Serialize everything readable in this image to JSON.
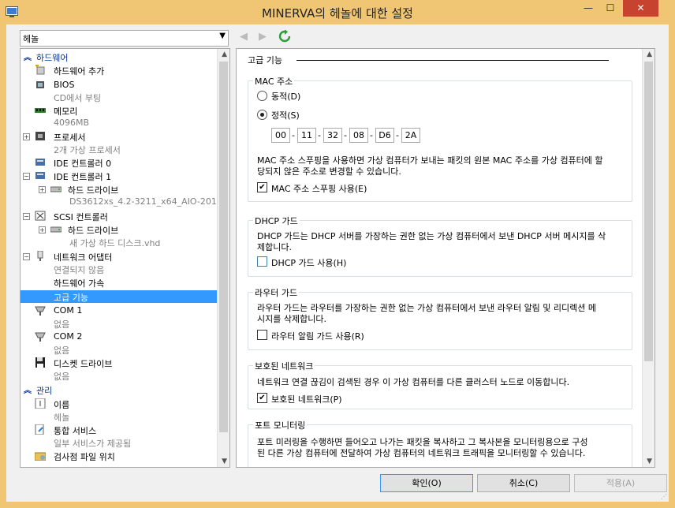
{
  "window": {
    "title": "MINERVA의 헤놀에 대한 설정",
    "minimize": "—",
    "maximize": "☐",
    "close": "✕"
  },
  "vm_selector": {
    "value": "헤놀"
  },
  "tree": {
    "hardware_section": "하드웨어",
    "items": [
      {
        "label": "하드웨어 추가",
        "sub": ""
      },
      {
        "label": "BIOS",
        "sub": "CD에서 부팅"
      },
      {
        "label": "메모리",
        "sub": "4096MB"
      },
      {
        "label": "프로세서",
        "sub": "2개 가상 프로세서"
      },
      {
        "label": "IDE 컨트롤러 0",
        "sub": ""
      },
      {
        "label": "IDE 컨트롤러 1",
        "sub": ""
      },
      {
        "label": "하드 드라이브",
        "sub": "DS3612xs_4.2-3211_x64_AIO-201..."
      },
      {
        "label": "SCSI 컨트롤러",
        "sub": ""
      },
      {
        "label": "하드 드라이브",
        "sub": "새 가상 하드 디스크.vhd"
      },
      {
        "label": "네트워크 어댑터",
        "sub": "연결되지 않음"
      },
      {
        "label": "하드웨어 가속",
        "sub": ""
      },
      {
        "label": "고급 기능",
        "sub": ""
      },
      {
        "label": "COM 1",
        "sub": "없음"
      },
      {
        "label": "COM 2",
        "sub": "없음"
      },
      {
        "label": "디스켓 드라이브",
        "sub": "없음"
      }
    ],
    "management_section": "관리",
    "mgmt_items": [
      {
        "label": "이름",
        "sub": "헤놀"
      },
      {
        "label": "통합 서비스",
        "sub": "일부 서비스가 제공됨"
      },
      {
        "label": "검사점 파일 위치",
        "sub": ""
      }
    ]
  },
  "panel": {
    "heading": "고급 기능",
    "mac": {
      "title": "MAC 주소",
      "dynamic": "동적(D)",
      "static": "정적(S)",
      "octets": [
        "00",
        "11",
        "32",
        "08",
        "D6",
        "2A"
      ],
      "desc1": "MAC 주소 스푸핑을 사용하면 가상 컴퓨터가 보내는 패킷의 원본 MAC 주소를 가상 컴퓨터에 할",
      "desc2": "당되지 않은 주소로 변경할 수 있습니다.",
      "spoof_label": "MAC 주소 스푸핑 사용(E)",
      "spoof_checked": true
    },
    "dhcp": {
      "title": "DHCP 가드",
      "desc1": "DHCP 가드는 DHCP 서버를 가장하는 권한 없는 가상 컴퓨터에서 보낸 DHCP 서버 메시지를 삭",
      "desc2": "제합니다.",
      "label": "DHCP 가드 사용(H)",
      "checked": false
    },
    "router": {
      "title": "라우터 가드",
      "desc1": "라우터 가드는 라우터를 가장하는 권한 없는 가상 컴퓨터에서 보낸 라우터 알림 및 리디렉션 메",
      "desc2": "시지를 삭제합니다.",
      "label": "라우터 알림 가드 사용(R)",
      "checked": false
    },
    "protected": {
      "title": "보호된 네트워크",
      "desc1": "네트워크 연결 끊김이 검색된 경우 이 가상 컴퓨터를 다른 클러스터 노드로 이동합니다.",
      "label": "보호된 네트워크(P)",
      "checked": true
    },
    "port_mirror": {
      "title": "포트 모니터링",
      "desc1": "포트 미러링을 수행하면 들어오고 나가는 패킷을 복사하고 그 복사본을 모니터링용으로 구성",
      "desc2": "된 다른 가상 컴퓨터에 전달하여 가상 컴퓨터의 네트워크 트래픽을 모니터링할 수 있습니다."
    }
  },
  "buttons": {
    "ok": "확인(O)",
    "cancel": "취소(C)",
    "apply": "적용(A)"
  }
}
